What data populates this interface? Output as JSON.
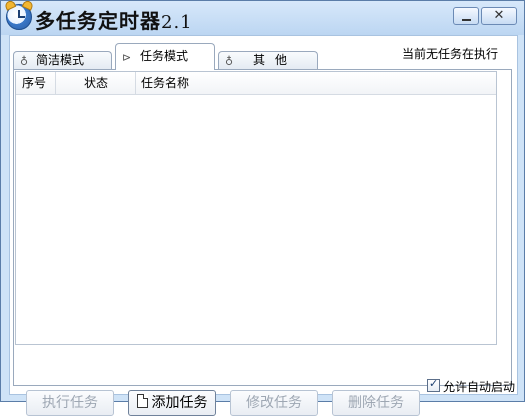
{
  "window": {
    "title": "多任务定时器",
    "version": "2.1"
  },
  "tabs": [
    {
      "label": "简洁模式",
      "icon": "pin-icon"
    },
    {
      "label": "任务模式",
      "icon": "play-doc-icon",
      "selected": true
    },
    {
      "label": "其他",
      "icon": "pin-icon"
    }
  ],
  "status_text": "当前无任务在执行",
  "task_list": {
    "columns": [
      "序号",
      "状态",
      "任务名称"
    ],
    "rows": []
  },
  "auto_start": {
    "label": "允许自动启动",
    "checked": true
  },
  "buttons": {
    "run": "执行任务",
    "add": "添加任务",
    "edit": "修改任务",
    "delete": "删除任务"
  }
}
